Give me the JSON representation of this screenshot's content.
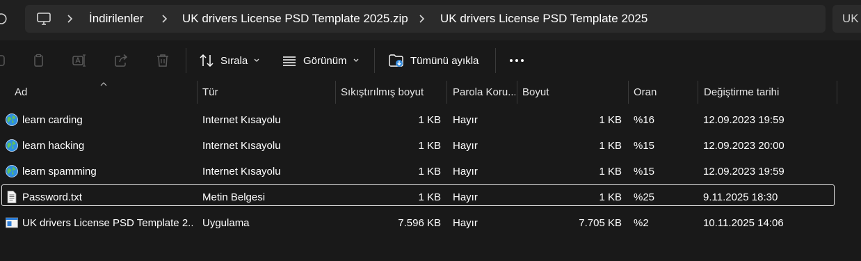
{
  "address_bar": {
    "breadcrumbs": [
      "İndirilenler",
      "UK drivers License PSD Template 2025.zip",
      "UK drivers License PSD Template 2025"
    ],
    "search_text": "UK"
  },
  "toolbar": {
    "sort_label": "Sırala",
    "view_label": "Görünüm",
    "extract_all_label": "Tümünü ayıkla"
  },
  "columns": [
    "Ad",
    "Tür",
    "Sıkıştırılmış boyut",
    "Parola Koru...",
    "Boyut",
    "Oran",
    "Değiştirme tarihi"
  ],
  "files": [
    {
      "icon": "internet-shortcut-icon",
      "name": "learn carding",
      "type": "Internet Kısayolu",
      "compressed": "1 KB",
      "password": "Hayır",
      "size": "1 KB",
      "ratio": "%16",
      "modified": "12.09.2023 19:59"
    },
    {
      "icon": "internet-shortcut-icon",
      "name": "learn hacking",
      "type": "Internet Kısayolu",
      "compressed": "1 KB",
      "password": "Hayır",
      "size": "1 KB",
      "ratio": "%15",
      "modified": "12.09.2023 20:00"
    },
    {
      "icon": "internet-shortcut-icon",
      "name": "learn spamming",
      "type": "Internet Kısayolu",
      "compressed": "1 KB",
      "password": "Hayır",
      "size": "1 KB",
      "ratio": "%15",
      "modified": "12.09.2023 19:59"
    },
    {
      "icon": "text-document-icon",
      "name": "Password.txt",
      "type": "Metin Belgesi",
      "compressed": "1 KB",
      "password": "Hayır",
      "size": "1 KB",
      "ratio": "%25",
      "modified": "9.11.2025 18:30",
      "selected": true
    },
    {
      "icon": "application-icon",
      "name": "UK drivers License PSD Template 2...",
      "type": "Uygulama",
      "compressed": "7.596 KB",
      "password": "Hayır",
      "size": "7.705 KB",
      "ratio": "%2",
      "modified": "10.11.2025 14:06"
    }
  ]
}
